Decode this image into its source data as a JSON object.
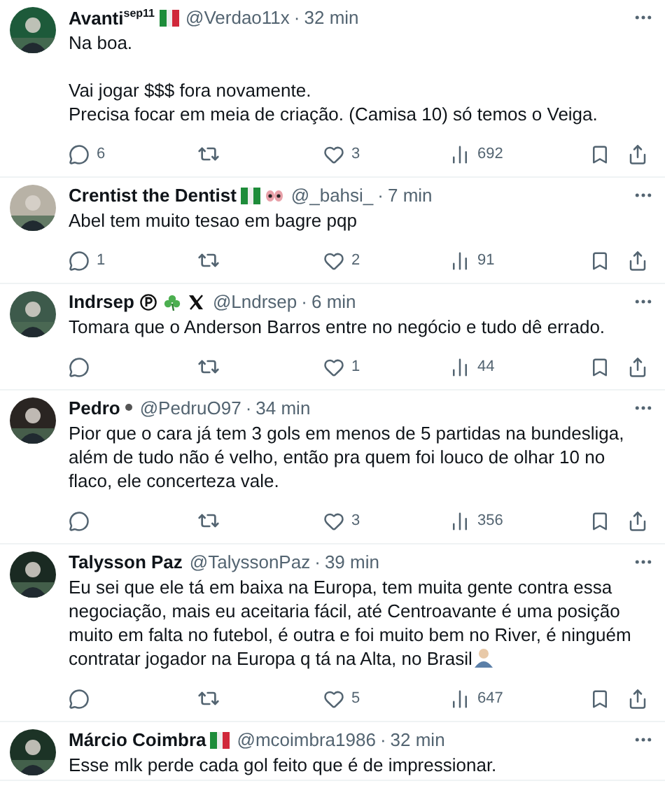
{
  "tweets": [
    {
      "name": "Avanti$^{sep11}$",
      "badges": [
        {
          "kind": "italy-flag"
        }
      ],
      "handle": "@Verdao11x",
      "dot": "·",
      "time": "32 min",
      "paragraphs": [
        [
          "Na boa."
        ],
        [
          "Vai jogar $$$ fora novamente.",
          "Precisa focar em meia de criação. (Camisa 10) só temos o Veiga."
        ]
      ],
      "actions": {
        "replies": "6",
        "likes": "3",
        "views": "692"
      }
    },
    {
      "name": "Crentist the Dentist",
      "badges": [
        {
          "kind": "nigeria-flag"
        },
        {
          "kind": "eyes"
        }
      ],
      "handle": "@_bahsi_",
      "dot": "·",
      "time": "7 min",
      "paragraphs": [
        [
          "Abel tem muito tesao em bagre pqp"
        ]
      ],
      "actions": {
        "replies": "1",
        "likes": "2",
        "views": "91"
      }
    },
    {
      "name": "Indrsep",
      "badges": [
        {
          "kind": "p-circle"
        },
        {
          "kind": "shamrock"
        },
        {
          "kind": "x-logo"
        }
      ],
      "handle": "@Lndrsep",
      "dot": "·",
      "time": "6 min",
      "paragraphs": [
        [
          "Tomara que o Anderson Barros entre no negócio e tudo dê errado."
        ]
      ],
      "actions": {
        "likes": "1",
        "views": "44"
      }
    },
    {
      "name": "Pedro",
      "badges": [
        {
          "kind": "dot"
        }
      ],
      "handle": "@PedruO97",
      "dot": "·",
      "time": "34 min",
      "paragraphs": [
        [
          "Pior que o cara já tem 3 gols em menos de 5 partidas na bundesliga, além de tudo não é velho, então pra quem foi louco de olhar 10 no flaco, ele concerteza vale."
        ]
      ],
      "actions": {
        "likes": "3",
        "views": "356"
      }
    },
    {
      "name": "Talysson Paz",
      "handle": "@TalyssonPaz",
      "dot": "·",
      "time": "39 min",
      "paragraphs": [
        [
          "Eu sei que ele tá em baixa na Europa, tem muita gente contra essa negociação, mais eu aceitaria fácil, até Centroavante é uma posição muito em falta no futebol, é outra e foi muito bem no River, é ninguém contratar jogador na Europa q tá na Alta, no Brasil"
        ]
      ],
      "trailing": [
        {
          "kind": "shrug"
        }
      ],
      "actions": {
        "likes": "5",
        "views": "647"
      }
    },
    {
      "name": "Márcio Coimbra",
      "badges": [
        {
          "kind": "italy-flag"
        }
      ],
      "handle": "@mcoimbra1986",
      "dot": "·",
      "time": "32 min",
      "paragraphs": [
        [
          "Esse mlk perde cada gol feito que é de impressionar."
        ]
      ]
    }
  ]
}
